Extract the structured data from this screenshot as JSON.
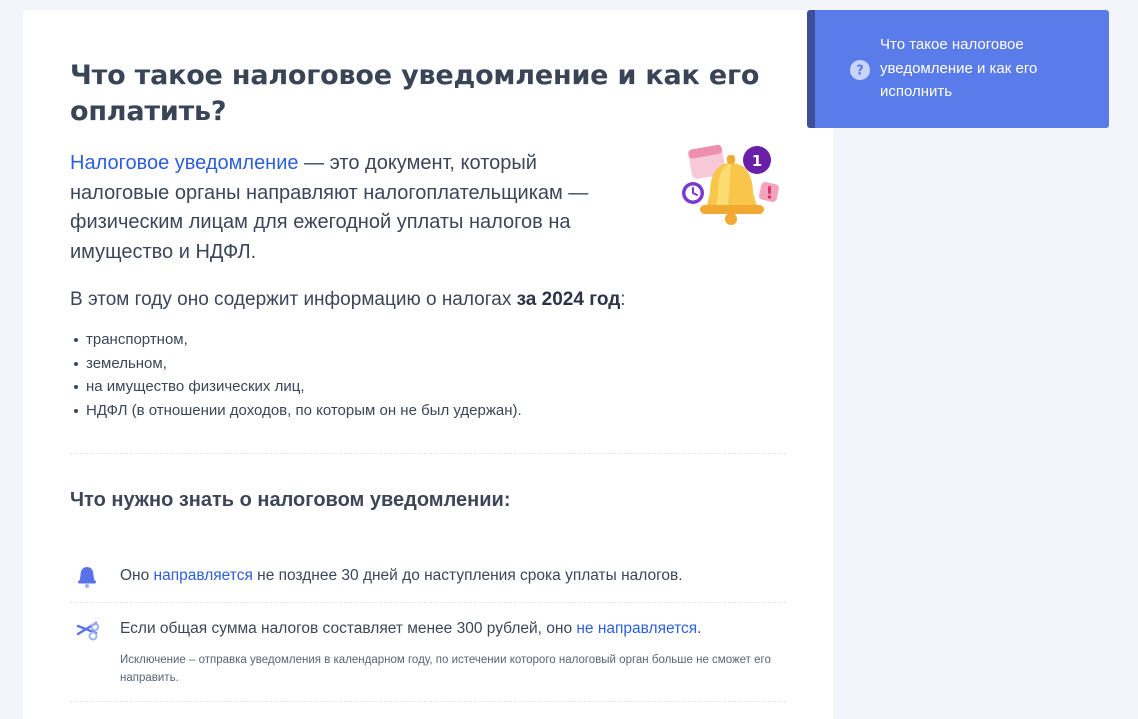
{
  "article": {
    "title": "Что такое налоговое уведомление и как его оплатить?",
    "intro_link": "Налоговое уведомление",
    "intro_rest": " — это документ, который налоговые органы направляют налогоплательщикам — физическим лицам для ежегодной уплаты налогов на имущество и НДФЛ.",
    "year_text": "В этом году оно содержит информацию о налогах ",
    "year_bold": "за 2024 год",
    "year_tail": ":",
    "taxes": [
      "транспортном,",
      "земельном,",
      "на имущество физических лиц,",
      "НДФЛ (в отношении доходов, по которым он не был удержан)."
    ],
    "subheading": "Что нужно знать о налоговом уведомлении:",
    "facts": [
      {
        "before": "Оно ",
        "link": "направляется",
        "after": " не позднее 30 дней до наступления срока уплаты налогов.",
        "icon": "bell-icon"
      },
      {
        "before": "Если общая сумма налогов составляет менее 300 рублей, оно ",
        "link": "не направляется",
        "after": ".",
        "note": "Исключение – отправка уведомления в календарном году, по истечении которого налоговый орган больше не сможет его направить.",
        "icon": "scissors-icon"
      }
    ],
    "badge_count": "1"
  },
  "sidebar": {
    "item_label": "Что такое налоговое уведомление и как его исполнить",
    "icon": "question-circle-icon"
  },
  "colors": {
    "link": "#2d5fd8",
    "sidebar_bg": "#5a7cea",
    "sidebar_accent": "#3e4f9a",
    "badge": "#6a1fa8"
  }
}
